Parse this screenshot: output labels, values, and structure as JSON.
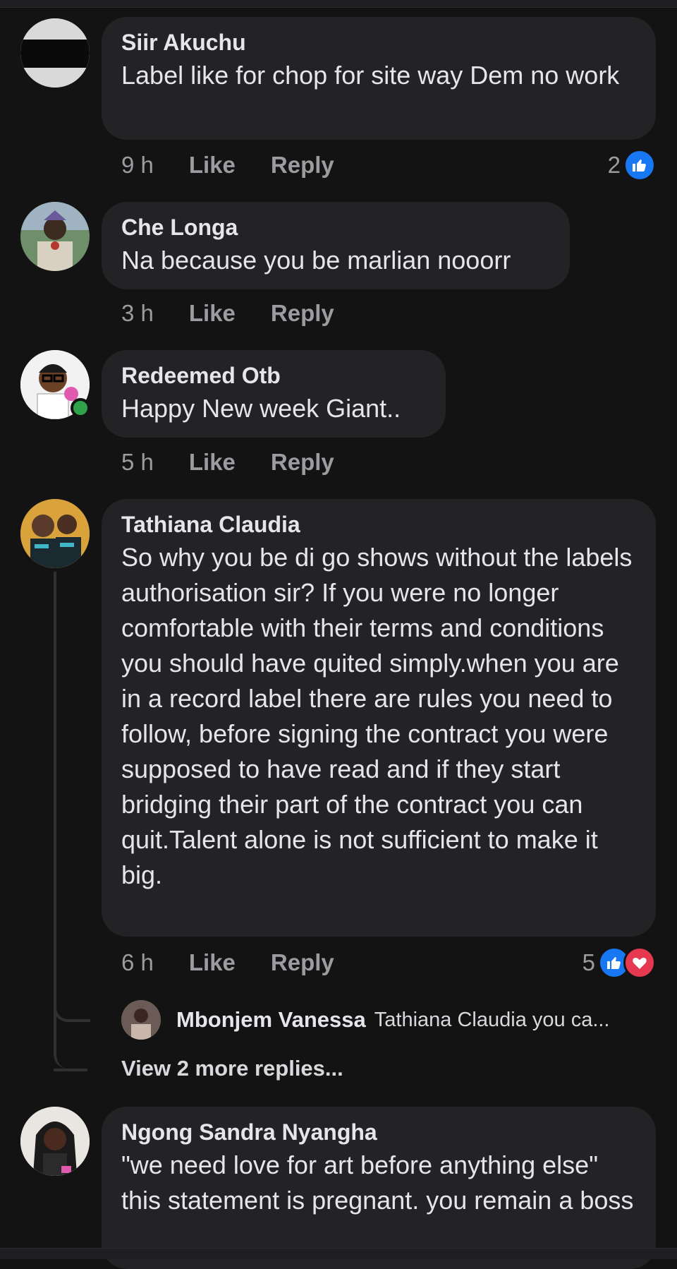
{
  "comments": [
    {
      "author": "Siir Akuchu",
      "text": "Label like for chop for site way Dem no work",
      "time": "9 h",
      "like_label": "Like",
      "reply_label": "Reply",
      "reaction_count": "2"
    },
    {
      "author": "Che Longa",
      "text": "Na because you be marlian nooorr",
      "time": "3 h",
      "like_label": "Like",
      "reply_label": "Reply"
    },
    {
      "author": "Redeemed Otb",
      "text": "Happy New week Giant..",
      "time": "5 h",
      "like_label": "Like",
      "reply_label": "Reply"
    },
    {
      "author": "Tathiana Claudia",
      "text": "So why you be di go shows without the labels authorisation sir? If you were no longer comfortable with their terms and conditions you should have quited simply.when you are in a record label there are rules you need to follow, before signing the contract you were supposed to have read and if they start bridging their part of the contract you can quit.Talent alone is not sufficient to make it big.",
      "time": "6 h",
      "like_label": "Like",
      "reply_label": "Reply",
      "reaction_count": "5",
      "reply": {
        "author": "Mbonjem Vanessa",
        "text": "Tathiana Claudia you ca..."
      },
      "more_replies": "View 2 more replies..."
    },
    {
      "author": "Ngong Sandra Nyangha",
      "text": "\"we need love for art before anything else\" this statement is pregnant. you remain a boss"
    }
  ],
  "colors": {
    "background": "#131314",
    "bubble": "#232325",
    "like_blue": "#1877f2",
    "love_red": "#e63950",
    "online_green": "#31a24c"
  }
}
